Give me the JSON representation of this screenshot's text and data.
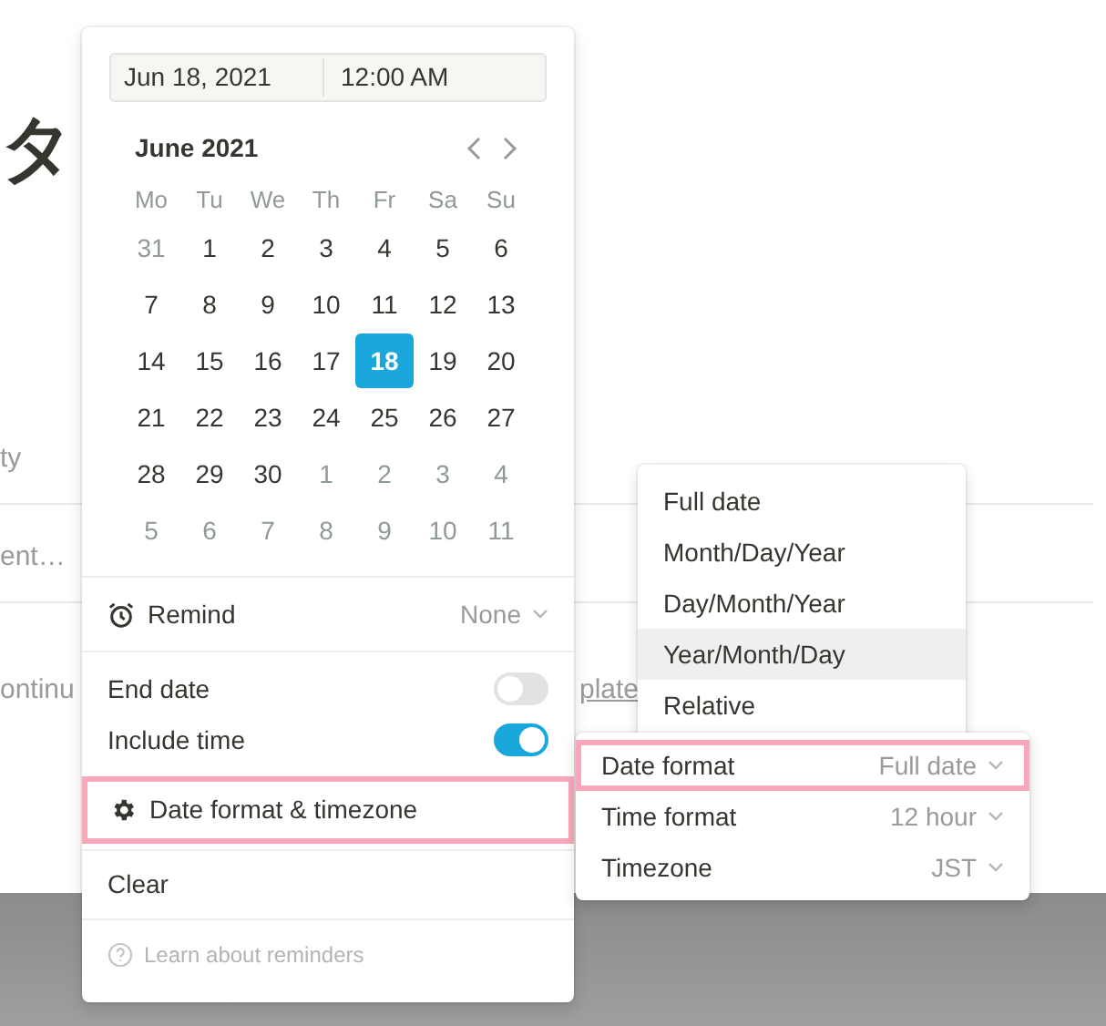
{
  "background": {
    "heading": "タ",
    "fragments": [
      {
        "text": "ty",
        "kind": "plain"
      },
      {
        "text": "ent…",
        "kind": "plain"
      },
      {
        "text": "ontinu",
        "kind": "plain"
      },
      {
        "text": "plate",
        "kind": "link"
      }
    ]
  },
  "date_picker": {
    "date": "Jun 18, 2021",
    "time": "12:00 AM",
    "month": "June 2021",
    "weekdays": [
      "Mo",
      "Tu",
      "We",
      "Th",
      "Fr",
      "Sa",
      "Su"
    ],
    "weeks": [
      [
        {
          "day": "31",
          "in_month": false,
          "selected": false
        },
        {
          "day": "1",
          "in_month": true,
          "selected": false
        },
        {
          "day": "2",
          "in_month": true,
          "selected": false
        },
        {
          "day": "3",
          "in_month": true,
          "selected": false
        },
        {
          "day": "4",
          "in_month": true,
          "selected": false
        },
        {
          "day": "5",
          "in_month": true,
          "selected": false
        },
        {
          "day": "6",
          "in_month": true,
          "selected": false
        }
      ],
      [
        {
          "day": "7",
          "in_month": true,
          "selected": false
        },
        {
          "day": "8",
          "in_month": true,
          "selected": false
        },
        {
          "day": "9",
          "in_month": true,
          "selected": false
        },
        {
          "day": "10",
          "in_month": true,
          "selected": false
        },
        {
          "day": "11",
          "in_month": true,
          "selected": false
        },
        {
          "day": "12",
          "in_month": true,
          "selected": false
        },
        {
          "day": "13",
          "in_month": true,
          "selected": false
        }
      ],
      [
        {
          "day": "14",
          "in_month": true,
          "selected": false
        },
        {
          "day": "15",
          "in_month": true,
          "selected": false
        },
        {
          "day": "16",
          "in_month": true,
          "selected": false
        },
        {
          "day": "17",
          "in_month": true,
          "selected": false
        },
        {
          "day": "18",
          "in_month": true,
          "selected": true
        },
        {
          "day": "19",
          "in_month": true,
          "selected": false
        },
        {
          "day": "20",
          "in_month": true,
          "selected": false
        }
      ],
      [
        {
          "day": "21",
          "in_month": true,
          "selected": false
        },
        {
          "day": "22",
          "in_month": true,
          "selected": false
        },
        {
          "day": "23",
          "in_month": true,
          "selected": false
        },
        {
          "day": "24",
          "in_month": true,
          "selected": false
        },
        {
          "day": "25",
          "in_month": true,
          "selected": false
        },
        {
          "day": "26",
          "in_month": true,
          "selected": false
        },
        {
          "day": "27",
          "in_month": true,
          "selected": false
        }
      ],
      [
        {
          "day": "28",
          "in_month": true,
          "selected": false
        },
        {
          "day": "29",
          "in_month": true,
          "selected": false
        },
        {
          "day": "30",
          "in_month": true,
          "selected": false
        },
        {
          "day": "1",
          "in_month": false,
          "selected": false
        },
        {
          "day": "2",
          "in_month": false,
          "selected": false
        },
        {
          "day": "3",
          "in_month": false,
          "selected": false
        },
        {
          "day": "4",
          "in_month": false,
          "selected": false
        }
      ],
      [
        {
          "day": "5",
          "in_month": false,
          "selected": false
        },
        {
          "day": "6",
          "in_month": false,
          "selected": false
        },
        {
          "day": "7",
          "in_month": false,
          "selected": false
        },
        {
          "day": "8",
          "in_month": false,
          "selected": false
        },
        {
          "day": "9",
          "in_month": false,
          "selected": false
        },
        {
          "day": "10",
          "in_month": false,
          "selected": false
        },
        {
          "day": "11",
          "in_month": false,
          "selected": false
        }
      ]
    ],
    "remind": {
      "label": "Remind",
      "value": "None"
    },
    "toggles": [
      {
        "label": "End date",
        "on": false
      },
      {
        "label": "Include time",
        "on": true
      }
    ],
    "settings": {
      "label": "Date format & timezone",
      "highlighted": true
    },
    "clear": "Clear",
    "help": "Learn about reminders"
  },
  "format_menu": [
    {
      "label": "Date format",
      "value": "Full date",
      "highlighted": true
    },
    {
      "label": "Time format",
      "value": "12 hour",
      "highlighted": false
    },
    {
      "label": "Timezone",
      "value": "JST",
      "highlighted": false
    }
  ],
  "date_format_options": [
    {
      "label": "Full date",
      "selected": false
    },
    {
      "label": "Month/Day/Year",
      "selected": false
    },
    {
      "label": "Day/Month/Year",
      "selected": false
    },
    {
      "label": "Year/Month/Day",
      "selected": true
    },
    {
      "label": "Relative",
      "selected": false
    }
  ]
}
